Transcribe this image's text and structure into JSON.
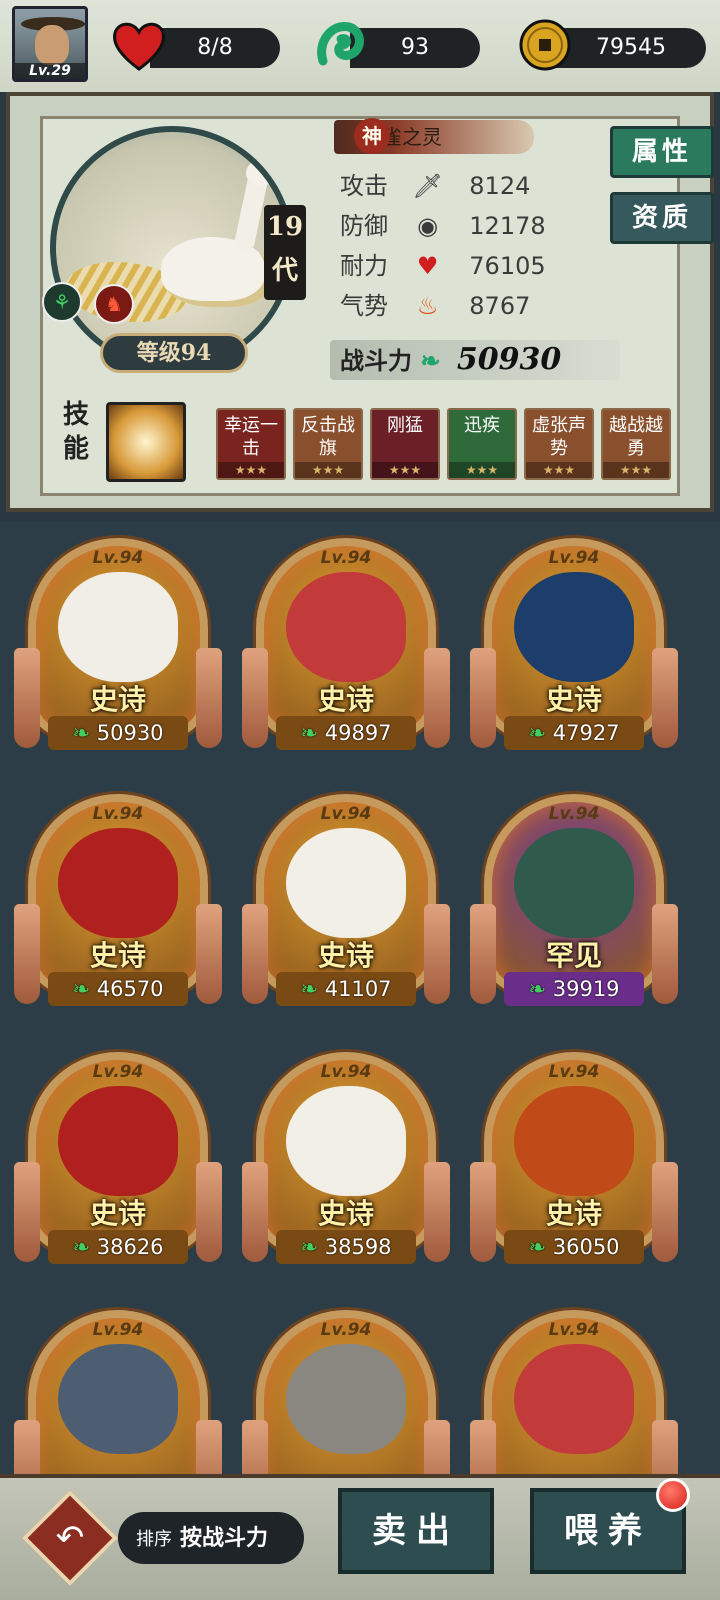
{
  "topbar": {
    "level": "Lv.29",
    "hearts": "8/8",
    "jade": "93",
    "coins": "79545"
  },
  "detail": {
    "name_prefix": "神",
    "name": "雀之灵",
    "generation": "19代",
    "level_label": "等级94",
    "stats": [
      {
        "label": "攻击",
        "icon": "sword-icon",
        "value": "8124"
      },
      {
        "label": "防御",
        "icon": "shield-icon",
        "value": "12178"
      },
      {
        "label": "耐力",
        "icon": "heart-icon",
        "value": "76105"
      },
      {
        "label": "气势",
        "icon": "flame-icon",
        "value": "8767"
      }
    ],
    "power_label": "战斗力",
    "power_value": "50930",
    "tab_attr": "属性",
    "tab_quality": "资质",
    "skill_label": "技能",
    "traits": [
      {
        "label": "幸运一击",
        "stars": "★★★",
        "color": "#7a2420"
      },
      {
        "label": "反击战旗",
        "stars": "★★★",
        "color": "#8a4f2c"
      },
      {
        "label": "刚猛",
        "stars": "★★★",
        "color": "#6b2028"
      },
      {
        "label": "迅疾",
        "stars": "★★★",
        "color": "#2f6b3a"
      },
      {
        "label": "虚张声势",
        "stars": "★★★",
        "color": "#8a4f2c"
      },
      {
        "label": "越战越勇",
        "stars": "★★★",
        "color": "#8a4f2c"
      }
    ]
  },
  "cards": [
    {
      "level": "Lv.94",
      "rarity": "史诗",
      "power": "50930",
      "bird": "#f0eee6",
      "frame": "#e09a32",
      "bar": "#7a4a14"
    },
    {
      "level": "Lv.94",
      "rarity": "史诗",
      "power": "49897",
      "bird": "#c23a3a",
      "frame": "#e09a32",
      "bar": "#7a4a14"
    },
    {
      "level": "Lv.94",
      "rarity": "史诗",
      "power": "47927",
      "bird": "#1d3e6a",
      "frame": "#e09a32",
      "bar": "#7a4a14"
    },
    {
      "level": "Lv.94",
      "rarity": "史诗",
      "power": "46570",
      "bird": "#b0201e",
      "frame": "#e09a32",
      "bar": "#7a4a14"
    },
    {
      "level": "Lv.94",
      "rarity": "史诗",
      "power": "41107",
      "bird": "#f2efe6",
      "frame": "#e09a32",
      "bar": "#7a4a14"
    },
    {
      "level": "Lv.94",
      "rarity": "罕见",
      "power": "39919",
      "bird": "#2f5a4c",
      "frame": "#7b3e9a",
      "bar": "#6a2e8a"
    },
    {
      "level": "Lv.94",
      "rarity": "史诗",
      "power": "38626",
      "bird": "#b0201e",
      "frame": "#e09a32",
      "bar": "#7a4a14"
    },
    {
      "level": "Lv.94",
      "rarity": "史诗",
      "power": "38598",
      "bird": "#f2efe6",
      "frame": "#e09a32",
      "bar": "#7a4a14"
    },
    {
      "level": "Lv.94",
      "rarity": "史诗",
      "power": "36050",
      "bird": "#c04a18",
      "frame": "#e09a32",
      "bar": "#7a4a14"
    },
    {
      "level": "Lv.94",
      "rarity": "",
      "power": "",
      "bird": "#4e5e72",
      "frame": "#e09a32",
      "bar": "#7a4a14"
    },
    {
      "level": "Lv.94",
      "rarity": "",
      "power": "",
      "bird": "#8a8680",
      "frame": "#e09a32",
      "bar": "#7a4a14"
    },
    {
      "level": "Lv.94",
      "rarity": "",
      "power": "",
      "bird": "#c23a3a",
      "frame": "#e09a32",
      "bar": "#7a4a14"
    }
  ],
  "bottom": {
    "sort_label": "排序",
    "sort_value": "按战斗力",
    "sell": "卖出",
    "feed": "喂养"
  }
}
